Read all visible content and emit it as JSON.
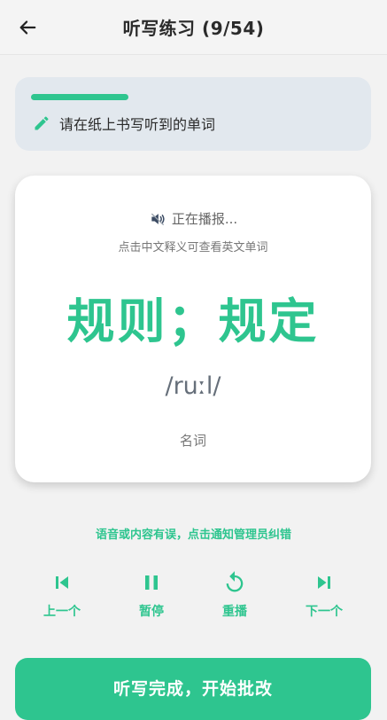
{
  "header": {
    "title": "听写练习 (9/54)",
    "back_icon": "arrow-left-icon"
  },
  "hint": {
    "progress": 0.3,
    "icon": "pencil-icon",
    "text": "请在纸上书写听到的单词"
  },
  "word_card": {
    "status_icon": "speaker-icon",
    "status": "正在播报...",
    "tip": "点击中文释义可查看英文单词",
    "meaning": "规则；规定",
    "phonetic": "/ruːl/",
    "part_of_speech": "名词"
  },
  "report_link": "语音或内容有误，点击通知管理员纠错",
  "controls": [
    {
      "icon": "skip-previous-icon",
      "label": "上一个"
    },
    {
      "icon": "pause-icon",
      "label": "暂停"
    },
    {
      "icon": "replay-icon",
      "label": "重播"
    },
    {
      "icon": "skip-next-icon",
      "label": "下一个"
    }
  ],
  "finish_button": "听写完成，开始批改",
  "colors": {
    "accent": "#2ec58f",
    "hint_bg": "#e2e8ee",
    "page_bg": "#f2f2f2"
  }
}
